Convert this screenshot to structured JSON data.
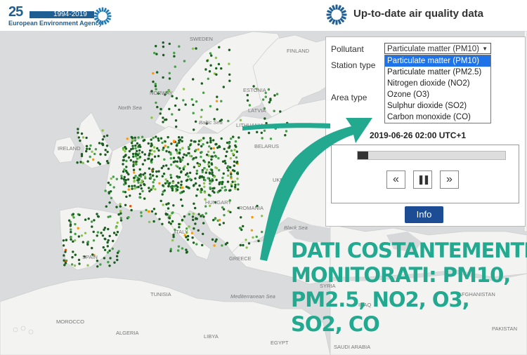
{
  "header": {
    "logo_number": "25",
    "logo_years": "1994-2019",
    "agency_name": "European Environment Agency",
    "app_title": "Up-to-date air quality data"
  },
  "map": {
    "labels": [
      {
        "text": "SWEDEN",
        "italic": false
      },
      {
        "text": "FINLAND",
        "italic": false
      },
      {
        "text": "NORWAY",
        "italic": false
      },
      {
        "text": "ESTONIA",
        "italic": false
      },
      {
        "text": "LATVIA",
        "italic": false
      },
      {
        "text": "LITHUANIA",
        "italic": false
      },
      {
        "text": "North Sea",
        "italic": true
      },
      {
        "text": "Baltic Sea",
        "italic": true
      },
      {
        "text": "IRELAND",
        "italic": false
      },
      {
        "text": "BELARUS",
        "italic": false
      },
      {
        "text": "UKRAINE",
        "italic": false
      },
      {
        "text": "HUNGARY",
        "italic": false
      },
      {
        "text": "ROMANIA",
        "italic": false
      },
      {
        "text": "Black Sea",
        "italic": true
      },
      {
        "text": "ITALY",
        "italic": false
      },
      {
        "text": "SPAIN",
        "italic": false
      },
      {
        "text": "GREECE",
        "italic": false
      },
      {
        "text": "TUNISIA",
        "italic": false
      },
      {
        "text": "Mediterranean Sea",
        "italic": true
      },
      {
        "text": "MOROCCO",
        "italic": false
      },
      {
        "text": "ALGERIA",
        "italic": false
      },
      {
        "text": "LIBYA",
        "italic": false
      },
      {
        "text": "EGYPT",
        "italic": false
      },
      {
        "text": "SYRIA",
        "italic": false
      },
      {
        "text": "IRAQ",
        "italic": false
      },
      {
        "text": "AFGHANISTAN",
        "italic": false
      },
      {
        "text": "PAKISTAN",
        "italic": false
      },
      {
        "text": "SAUDI ARABIA",
        "italic": false
      }
    ]
  },
  "panel": {
    "pollutant_label": "Pollutant",
    "station_type_label": "Station type",
    "area_type_label": "Area type",
    "pollutant_selected": "Particulate matter (PM10)",
    "pollutant_options": [
      "Particulate matter (PM10)",
      "Particulate matter (PM2.5)",
      "Nitrogen dioxide (NO2)",
      "Ozone (O3)",
      "Sulphur dioxide (SO2)",
      "Carbon monoxide (CO)"
    ],
    "timestamp": "2019-06-26 02:00 UTC+1",
    "progress_fraction": 0.07,
    "rewind_label": "«",
    "pause_label": "❚❚",
    "forward_label": "»",
    "info_label": "Info"
  },
  "overlay": {
    "lines": [
      "DATI COSTANTEMENTE",
      "MONITORATI: PM10,",
      "PM2.5, NO2, O3,",
      "SO2, CO"
    ]
  },
  "colors": {
    "brand_blue": "#1f5e93",
    "accent_teal": "#22a98f",
    "info_button": "#1c4c93",
    "dot_dark_green": "#1b5e20",
    "dot_green": "#43a047",
    "dot_light_green": "#8bc34a",
    "dot_orange": "#ff9800",
    "dot_red": "#e65100"
  }
}
